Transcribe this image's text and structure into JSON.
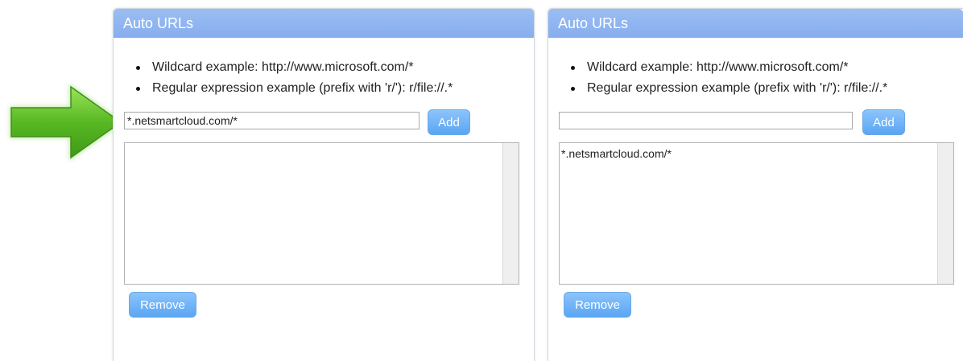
{
  "arrow": {
    "color": "#5fbf2a",
    "icon": "green-right-arrow"
  },
  "colors": {
    "header": "#8db3f0",
    "button": "#6aaef6"
  },
  "panels": [
    {
      "header": "Auto URLs",
      "hints": [
        "Wildcard example: http://www.microsoft.com/*",
        "Regular expression example (prefix with 'r/'): r/file://.*"
      ],
      "input_value": "*.netsmartcloud.com/*",
      "add_label": "Add",
      "list_items": [],
      "remove_label": "Remove"
    },
    {
      "header": "Auto URLs",
      "hints": [
        "Wildcard example: http://www.microsoft.com/*",
        "Regular expression example (prefix with 'r/'): r/file://.*"
      ],
      "input_value": "",
      "add_label": "Add",
      "list_items": [
        "*.netsmartcloud.com/*"
      ],
      "remove_label": "Remove"
    }
  ]
}
